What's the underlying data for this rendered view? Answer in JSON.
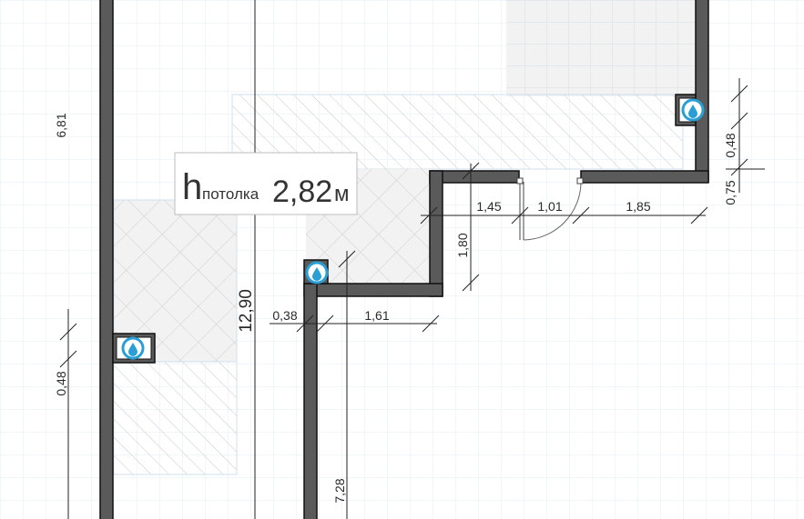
{
  "ceiling": {
    "prefix": "h",
    "label": "потолка",
    "value": "2,82",
    "unit": "м"
  },
  "dimensions": {
    "left_height": "6,81",
    "left_riser": "0,48",
    "total_height": "12,90",
    "step_short": "0,38",
    "step_width": "1,61",
    "lower_height": "7,28",
    "notch_width": "1,45",
    "notch_height": "1,80",
    "door_width": "1,01",
    "right_segment": "1,85",
    "right_riser": "0,48",
    "right_gap": "0,75"
  },
  "colors": {
    "wall_fill": "#5a5a5a",
    "wall_stroke": "#111111",
    "grid": "#d4e4ef",
    "water_icon": "#2a9fd6"
  },
  "icons": [
    "water-drop-icon"
  ]
}
